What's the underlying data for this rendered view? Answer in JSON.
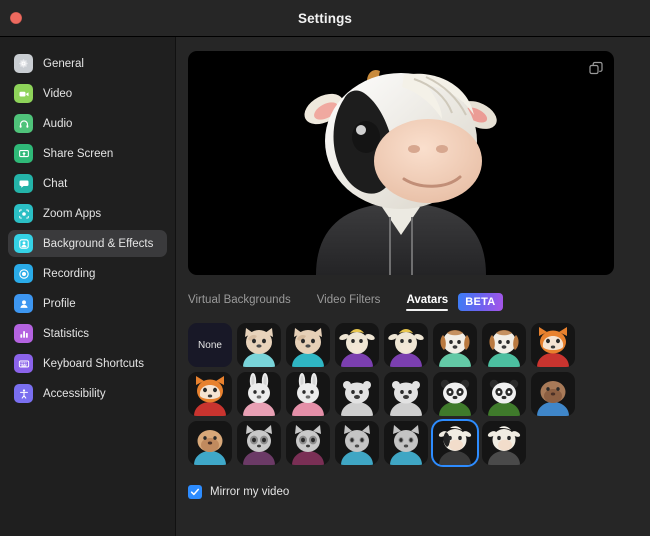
{
  "window": {
    "title": "Settings",
    "close_button": "close"
  },
  "sidebar": {
    "items": [
      {
        "label": "General",
        "icon": "gear-icon",
        "color": "#c9cdd2",
        "active": false
      },
      {
        "label": "Video",
        "icon": "video-camera-icon",
        "color": "#8ed35a",
        "active": false
      },
      {
        "label": "Audio",
        "icon": "headphones-icon",
        "color": "#4fc37a",
        "active": false
      },
      {
        "label": "Share Screen",
        "icon": "share-screen-icon",
        "color": "#2fb978",
        "active": false
      },
      {
        "label": "Chat",
        "icon": "chat-bubble-icon",
        "color": "#24b3a8",
        "active": false
      },
      {
        "label": "Zoom Apps",
        "icon": "zoom-apps-icon",
        "color": "#2bbfc4",
        "active": false
      },
      {
        "label": "Background & Effects",
        "icon": "background-effects-icon",
        "color": "#35d2e6",
        "active": true
      },
      {
        "label": "Recording",
        "icon": "record-icon",
        "color": "#2aabe8",
        "active": false
      },
      {
        "label": "Profile",
        "icon": "person-icon",
        "color": "#3d96f0",
        "active": false
      },
      {
        "label": "Statistics",
        "icon": "bar-chart-icon",
        "color": "#b463e0",
        "active": false
      },
      {
        "label": "Keyboard Shortcuts",
        "icon": "keyboard-icon",
        "color": "#8b63ea",
        "active": false
      },
      {
        "label": "Accessibility",
        "icon": "accessibility-icon",
        "color": "#7a6ff0",
        "active": false
      }
    ]
  },
  "preview": {
    "popout_icon": "duplicate-window-icon",
    "avatar": "cow-avatar"
  },
  "tabs": [
    {
      "label": "Virtual Backgrounds",
      "active": false
    },
    {
      "label": "Video Filters",
      "active": false
    },
    {
      "label": "Avatars",
      "active": true
    }
  ],
  "beta_badge": "BETA",
  "avatars": {
    "none_label": "None",
    "items": [
      {
        "name": "none",
        "selected": false
      },
      {
        "name": "cat-tan-1",
        "selected": false,
        "animal": "cat",
        "fur": "#e8d3bb",
        "fur2": "#cdb193",
        "shirt": "#79d4d9",
        "eye": "#2a2a2a"
      },
      {
        "name": "cat-tan-2",
        "selected": false,
        "animal": "cat",
        "fur": "#e6d0b7",
        "fur2": "#c9ac8c",
        "shirt": "#2fb6c4",
        "eye": "#2a2a2a"
      },
      {
        "name": "goat-1",
        "selected": false,
        "animal": "goat",
        "fur": "#efe6d4",
        "fur2": "#d6c9b2",
        "shirt": "#7b3fb0",
        "eye": "#2a2a2a"
      },
      {
        "name": "goat-2",
        "selected": false,
        "animal": "goat",
        "fur": "#efe6d4",
        "fur2": "#d6c9b2",
        "shirt": "#7b3fb0",
        "eye": "#2a2a2a"
      },
      {
        "name": "dog-1",
        "selected": false,
        "animal": "dog",
        "fur": "#f2eee6",
        "fur2": "#b9793f",
        "shirt": "#63c9a6",
        "eye": "#2a2a2a"
      },
      {
        "name": "dog-2",
        "selected": false,
        "animal": "dog",
        "fur": "#f2eee6",
        "fur2": "#b9793f",
        "shirt": "#4cbfa0",
        "eye": "#2a2a2a"
      },
      {
        "name": "fox-1",
        "selected": false,
        "animal": "fox",
        "fur": "#e8812e",
        "fur2": "#f5e3d2",
        "shirt": "#c9342f",
        "eye": "#2a2a2a"
      },
      {
        "name": "fox-2",
        "selected": false,
        "animal": "fox",
        "fur": "#e8812e",
        "fur2": "#f5e3d2",
        "shirt": "#c9342f",
        "eye": "#2a2a2a"
      },
      {
        "name": "rabbit-1",
        "selected": false,
        "animal": "rabbit",
        "fur": "#ececec",
        "fur2": "#d4d4d4",
        "shirt": "#e8a0b4",
        "eye": "#2a2a2a"
      },
      {
        "name": "rabbit-2",
        "selected": false,
        "animal": "rabbit",
        "fur": "#ececec",
        "fur2": "#d4d4d4",
        "shirt": "#e48fa8",
        "eye": "#2a2a2a"
      },
      {
        "name": "bear-1",
        "selected": false,
        "animal": "bear",
        "fur": "#e2e2e2",
        "fur2": "#c2c2c2",
        "shirt": "#cfcfcf",
        "eye": "#2a2a2a"
      },
      {
        "name": "bear-2",
        "selected": false,
        "animal": "bear",
        "fur": "#e2e2e2",
        "fur2": "#c2c2c2",
        "shirt": "#cfcfcf",
        "eye": "#2a2a2a"
      },
      {
        "name": "panda-1",
        "selected": false,
        "animal": "panda",
        "fur": "#f0f0f0",
        "fur2": "#2b2b2b",
        "shirt": "#3f7a2b",
        "eye": "#2a2a2a"
      },
      {
        "name": "panda-2",
        "selected": false,
        "animal": "panda",
        "fur": "#f0f0f0",
        "fur2": "#2b2b2b",
        "shirt": "#3f7a2b",
        "eye": "#2a2a2a"
      },
      {
        "name": "walrus-1",
        "selected": false,
        "animal": "walrus",
        "fur": "#8c5f42",
        "fur2": "#a87a58",
        "shirt": "#3f86c9",
        "eye": "#2a2a2a"
      },
      {
        "name": "walrus-2",
        "selected": false,
        "animal": "walrus",
        "fur": "#c08a5e",
        "fur2": "#d8a879",
        "shirt": "#3fa8c9",
        "eye": "#2a2a2a"
      },
      {
        "name": "raccoon-1",
        "selected": false,
        "animal": "raccoon",
        "fur": "#c9c9c9",
        "fur2": "#8e8e8e",
        "shirt": "#6b3a66",
        "eye": "#2a2a2a"
      },
      {
        "name": "raccoon-2",
        "selected": false,
        "animal": "raccoon",
        "fur": "#c9c9c9",
        "fur2": "#8e8e8e",
        "shirt": "#7a2f55",
        "eye": "#2a2a2a"
      },
      {
        "name": "cat-gray-1",
        "selected": false,
        "animal": "graycat",
        "fur": "#c4c4c4",
        "fur2": "#9a9a9a",
        "shirt": "#3fa6c4",
        "eye": "#2a2a2a"
      },
      {
        "name": "cat-gray-2",
        "selected": false,
        "animal": "graycat",
        "fur": "#c4c4c4",
        "fur2": "#9a9a9a",
        "shirt": "#3fa6c4",
        "eye": "#2a2a2a"
      },
      {
        "name": "cow-1",
        "selected": true,
        "animal": "cow",
        "fur": "#f0ece2",
        "fur2": "#2b2b2b",
        "shirt": "#3a3a3a",
        "eye": "#2a2a2a"
      },
      {
        "name": "cow-2",
        "selected": false,
        "animal": "cow",
        "fur": "#f0ece2",
        "fur2": "#d8d2c4",
        "shirt": "#4a4a4a",
        "eye": "#2a2a2a"
      }
    ]
  },
  "mirror": {
    "label": "Mirror my video",
    "checked": true,
    "accent": "#2d8cff"
  },
  "colors": {
    "window_bg": "#262626",
    "sidebar_bg": "#1f1f1f",
    "selected_item_bg": "#3a3a3c",
    "preview_bg": "#000000",
    "accent_blue": "#2d8cff",
    "text_primary": "#e4e4e4",
    "text_muted": "#9a9a9a"
  }
}
